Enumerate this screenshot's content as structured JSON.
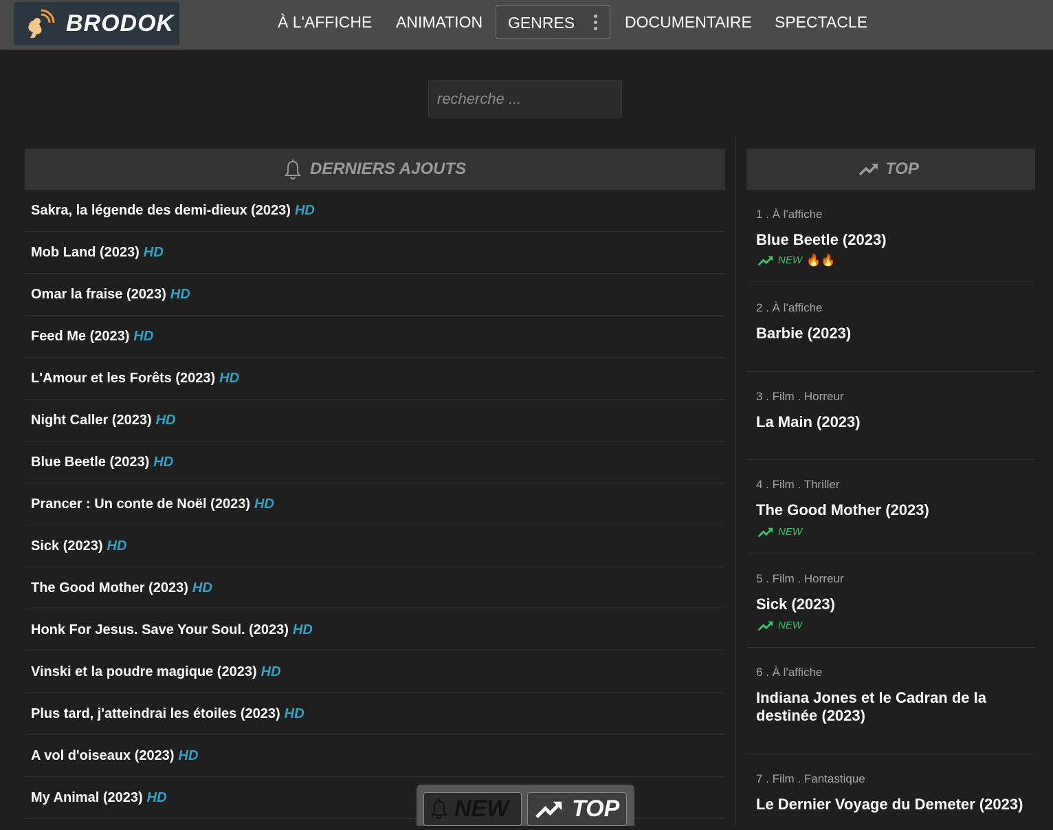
{
  "brand": {
    "name": "BRODOK"
  },
  "nav": {
    "items": [
      "À L'AFFICHE",
      "ANIMATION",
      "GENRES",
      "DOCUMENTAIRE",
      "SPECTACLE"
    ]
  },
  "search": {
    "placeholder": "recherche ..."
  },
  "latest": {
    "title": "DERNIERS AJOUTS",
    "hd_label": "HD",
    "items": [
      "Sakra, la légende des demi-dieux (2023)",
      "Mob Land (2023)",
      "Omar la fraise (2023)",
      "Feed Me (2023)",
      "L'Amour et les Forêts (2023)",
      "Night Caller (2023)",
      "Blue Beetle (2023)",
      "Prancer : Un conte de Noël (2023)",
      "Sick (2023)",
      "The Good Mother (2023)",
      "Honk For Jesus. Save Your Soul. (2023)",
      "Vinski et la poudre magique (2023)",
      "Plus tard, j'atteindrai les étoiles (2023)",
      "A vol d'oiseaux (2023)",
      "My Animal (2023)"
    ]
  },
  "top": {
    "title": "TOP",
    "new_label": "NEW",
    "items": [
      {
        "meta": "1 . À l'affiche",
        "title": "Blue Beetle (2023)",
        "new": true,
        "fire": "🔥🔥"
      },
      {
        "meta": "2 . À l'affiche",
        "title": "Barbie (2023)",
        "new": false,
        "fire": ""
      },
      {
        "meta": "3 . Film . Horreur",
        "title": "La Main (2023)",
        "new": false,
        "fire": ""
      },
      {
        "meta": "4 . Film . Thriller",
        "title": "The Good Mother (2023)",
        "new": true,
        "fire": ""
      },
      {
        "meta": "5 . Film . Horreur",
        "title": "Sick (2023)",
        "new": true,
        "fire": ""
      },
      {
        "meta": "6 . À l'affiche",
        "title": "Indiana Jones et le Cadran de la destinée (2023)",
        "new": false,
        "fire": ""
      },
      {
        "meta": "7 . Film . Fantastique",
        "title": "Le Dernier Voyage du Demeter (2023)",
        "new": false,
        "fire": ""
      }
    ]
  },
  "float_toggle": {
    "new_label": "NEW",
    "top_label": "TOP"
  },
  "colors": {
    "hd": "#2fa4c7",
    "new_badge": "#3ec46d",
    "background": "#1f1f1f",
    "header": "#4a4a4a"
  }
}
